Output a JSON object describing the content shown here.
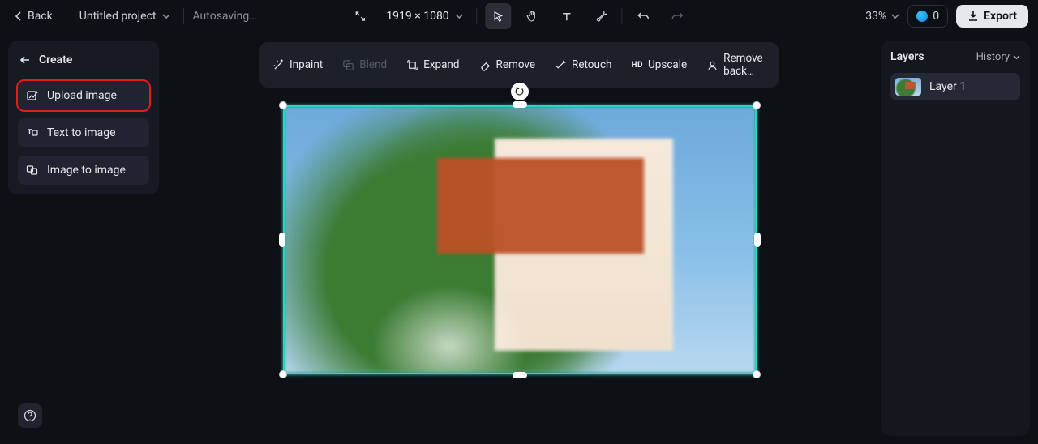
{
  "header": {
    "back": "Back",
    "project": "Untitled project",
    "status": "Autosaving…",
    "dimensions": "1919 × 1080",
    "zoom": "33%",
    "credits": "0",
    "export": "Export"
  },
  "create": {
    "title": "Create",
    "items": [
      {
        "label": "Upload image"
      },
      {
        "label": "Text to image"
      },
      {
        "label": "Image to image"
      }
    ]
  },
  "context_toolbar": {
    "items": [
      {
        "label": "Inpaint"
      },
      {
        "label": "Blend"
      },
      {
        "label": "Expand"
      },
      {
        "label": "Remove"
      },
      {
        "label": "Retouch"
      },
      {
        "label": "Upscale"
      },
      {
        "label": "Remove back…"
      }
    ]
  },
  "layers": {
    "title": "Layers",
    "history": "History",
    "items": [
      {
        "label": "Layer 1"
      }
    ]
  }
}
